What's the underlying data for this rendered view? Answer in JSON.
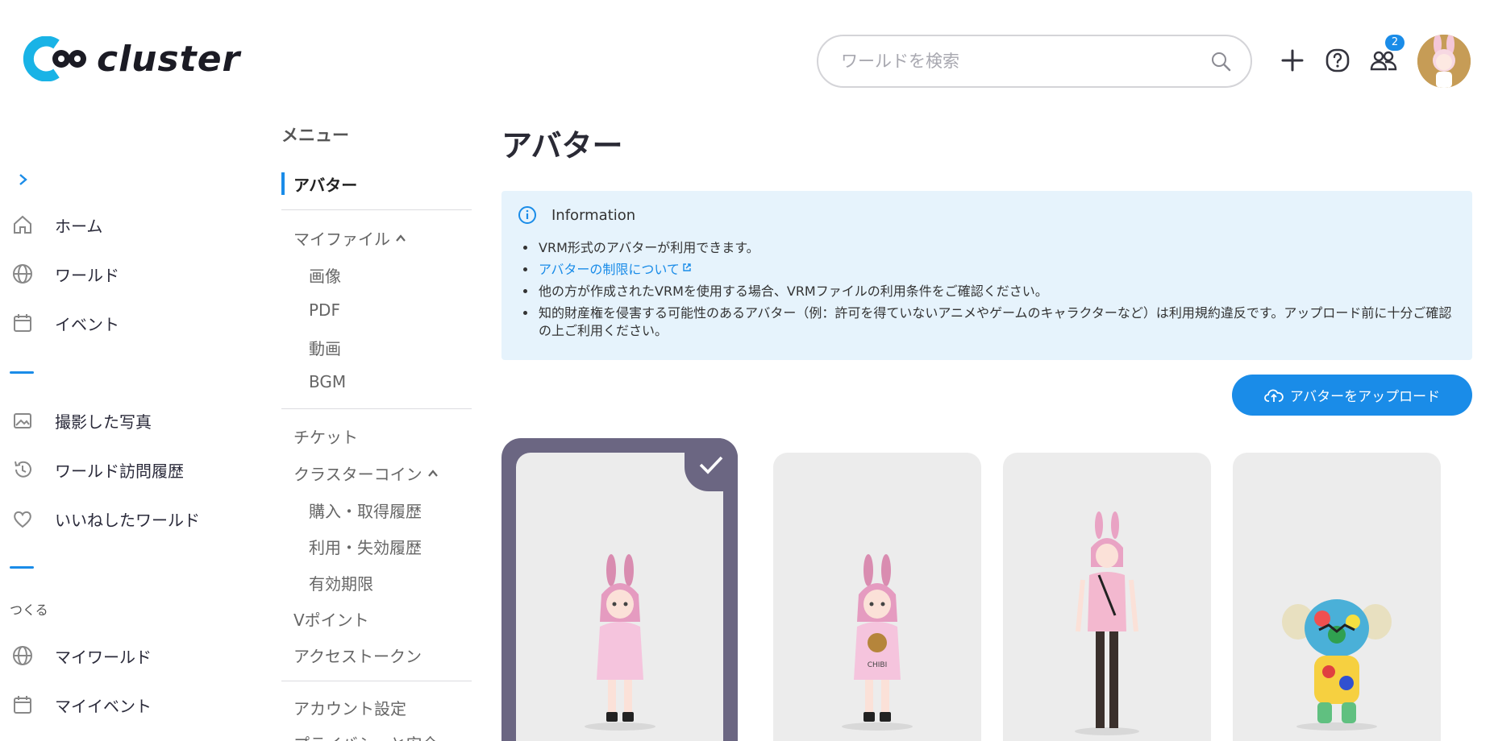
{
  "header": {
    "logo_text": "cluster",
    "search": {
      "placeholder": "ワールドを検索",
      "value": ""
    },
    "friends_badge": "2"
  },
  "sidebar": {
    "items": [
      {
        "label": "ホーム",
        "icon": "home-icon"
      },
      {
        "label": "ワールド",
        "icon": "globe-icon"
      },
      {
        "label": "イベント",
        "icon": "calendar-icon"
      },
      {
        "label": "撮影した写真",
        "icon": "photo-icon"
      },
      {
        "label": "ワールド訪問履歴",
        "icon": "history-icon"
      },
      {
        "label": "いいねしたワールド",
        "icon": "heart-icon"
      },
      {
        "label": "マイワールド",
        "icon": "globe-icon"
      },
      {
        "label": "マイイベント",
        "icon": "calendar-icon"
      }
    ],
    "group_label": "つくる"
  },
  "menu": {
    "title": "メニュー",
    "active": "アバター",
    "my_files": "マイファイル",
    "files": [
      "画像",
      "PDF",
      "動画",
      "BGM"
    ],
    "ticket": "チケット",
    "cluster_coin": "クラスターコイン",
    "coin_items": [
      "購入・取得履歴",
      "利用・失効履歴",
      "有効期限"
    ],
    "vpoint": "Vポイント",
    "access_token": "アクセストークン",
    "account": "アカウント設定",
    "privacy": "プライバシーと安全"
  },
  "main": {
    "title": "アバター",
    "info": {
      "heading": "Information",
      "bullets": [
        "VRM形式のアバターが利用できます。",
        "アバターの制限について",
        "他の方が作成されたVRMを使用する場合、VRMファイルの利用条件をご確認ください。",
        "知的財産権を侵害する可能性のあるアバター（例：許可を得ていないアニメやゲームのキャラクターなど）は利用規約違反です。アップロード前に十分ご確認の上ご利用ください。"
      ]
    },
    "upload_label": "アバターをアップロード",
    "card_text": "CHIBI"
  },
  "colors": {
    "accent": "#1a8ce8",
    "selected_frame": "#6b6682",
    "info_bg": "#e6f3fc"
  }
}
